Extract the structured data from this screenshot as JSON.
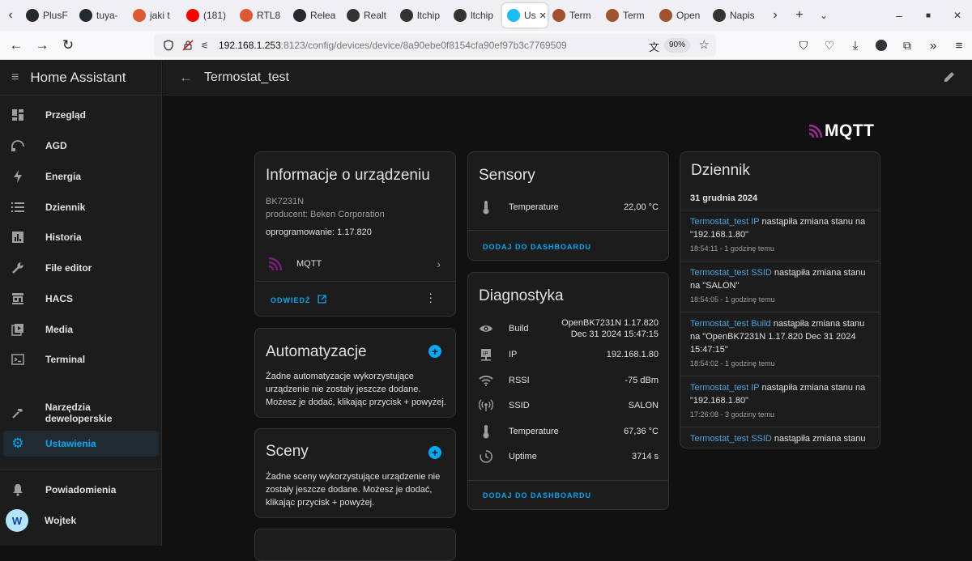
{
  "browser": {
    "tabs": [
      {
        "label": "PlusF",
        "fav": "github-icon",
        "color": "#24292e"
      },
      {
        "label": "tuya-",
        "fav": "github-icon",
        "color": "#24292e"
      },
      {
        "label": "jaki t",
        "fav": "duckduckgo-icon",
        "color": "#de5833"
      },
      {
        "label": "(181)",
        "fav": "youtube-icon",
        "color": "#ff0000"
      },
      {
        "label": "RTL8",
        "fav": "duckduckgo-icon",
        "color": "#de5833"
      },
      {
        "label": "Relea",
        "fav": "github-icon",
        "color": "#24292e"
      },
      {
        "label": "Realt",
        "fav": "forum-icon",
        "color": "#333333"
      },
      {
        "label": "ltchip",
        "fav": "forum-icon",
        "color": "#333333"
      },
      {
        "label": "ltchip",
        "fav": "forum-icon",
        "color": "#333333"
      },
      {
        "label": "Us",
        "fav": "home-assistant-icon",
        "color": "#18bcf2",
        "active": true
      },
      {
        "label": "Term",
        "fav": "gear-icon",
        "color": "#a0522d"
      },
      {
        "label": "Term",
        "fav": "gear-icon",
        "color": "#a0522d"
      },
      {
        "label": "Open",
        "fav": "gear-icon",
        "color": "#a0522d"
      },
      {
        "label": "Napis",
        "fav": "edge-icon",
        "color": "#333333"
      }
    ],
    "url_host": "192.168.1.253",
    "url_path": ":8123/config/devices/device/8a90ebe0f8154cfa90ef97b3c7769509",
    "zoom": "90%"
  },
  "sidebar": {
    "title": "Home Assistant",
    "items": [
      {
        "label": "Przegląd",
        "icon": "dashboard-icon"
      },
      {
        "label": "AGD",
        "icon": "appliance-icon"
      },
      {
        "label": "Energia",
        "icon": "lightning-icon"
      },
      {
        "label": "Dziennik",
        "icon": "list-icon"
      },
      {
        "label": "Historia",
        "icon": "chart-icon"
      },
      {
        "label": "File editor",
        "icon": "wrench-icon"
      },
      {
        "label": "HACS",
        "icon": "hacs-icon"
      },
      {
        "label": "Media",
        "icon": "media-icon"
      },
      {
        "label": "Terminal",
        "icon": "terminal-icon"
      }
    ],
    "dev_tools": "Narzędzia deweloperskie",
    "settings": "Ustawienia",
    "notifications": "Powiadomienia",
    "user": "Wojtek",
    "user_initial": "W"
  },
  "page": {
    "title": "Termostat_test",
    "integration_logo": "MQTT"
  },
  "device_info": {
    "title": "Informacje o urządzeniu",
    "model": "BK7231N",
    "manufacturer": "producent: Beken Corporation",
    "firmware": "oprogramowanie: 1.17.820",
    "integration": "MQTT",
    "visit": "ODWIEDŹ"
  },
  "automations": {
    "title": "Automatyzacje",
    "text": "Żadne automatyzacje wykorzystujące urządzenie nie zostały jeszcze dodane. Możesz je dodać, klikając przycisk + powyżej."
  },
  "scenes": {
    "title": "Sceny",
    "text": "Żadne sceny wykorzystujące urządzenie nie zostały jeszcze dodane. Możesz je dodać, klikając przycisk + powyżej."
  },
  "sensors": {
    "title": "Sensory",
    "rows": [
      {
        "label": "Temperature",
        "value": "22,00 °C",
        "icon": "thermometer-icon"
      }
    ],
    "add": "DODAJ DO DASHBOARDU"
  },
  "diagnostics": {
    "title": "Diagnostyka",
    "rows": [
      {
        "label": "Build",
        "value": "OpenBK7231N 1.17.820",
        "value2": "Dec 31 2024 15:47:15",
        "icon": "eye-icon"
      },
      {
        "label": "IP",
        "value": "192.168.1.80",
        "icon": "ip-network-icon"
      },
      {
        "label": "RSSI",
        "value": "-75 dBm",
        "icon": "wifi-icon"
      },
      {
        "label": "SSID",
        "value": "SALON",
        "icon": "access-point-icon"
      },
      {
        "label": "Temperature",
        "value": "67,36 °C",
        "icon": "thermometer-icon"
      },
      {
        "label": "Uptime",
        "value": "3714 s",
        "icon": "clock-icon"
      }
    ],
    "add": "DODAJ DO DASHBOARDU"
  },
  "logbook": {
    "title": "Dziennik",
    "date": "31 grudnia 2024",
    "entries": [
      {
        "entity": "Termostat_test IP",
        "text": " nastąpiła zmiana stanu na \"192.168.1.80\"",
        "time": "18:54:11 - 1 godzinę temu"
      },
      {
        "entity": "Termostat_test SSID",
        "text": " nastąpiła zmiana stanu na \"SALON\"",
        "time": "18:54:05 - 1 godzinę temu"
      },
      {
        "entity": "Termostat_test Build",
        "text": " nastąpiła zmiana stanu na \"OpenBK7231N 1.17.820 Dec 31 2024 15:47:15\"",
        "time": "18:54:02 - 1 godzinę temu"
      },
      {
        "entity": "Termostat_test IP",
        "text": " nastąpiła zmiana stanu na \"192.168.1.80\"",
        "time": "17:26:08 - 3 godziny temu"
      },
      {
        "entity": "Termostat_test SSID",
        "text": " nastąpiła zmiana stanu",
        "time": ""
      }
    ]
  }
}
